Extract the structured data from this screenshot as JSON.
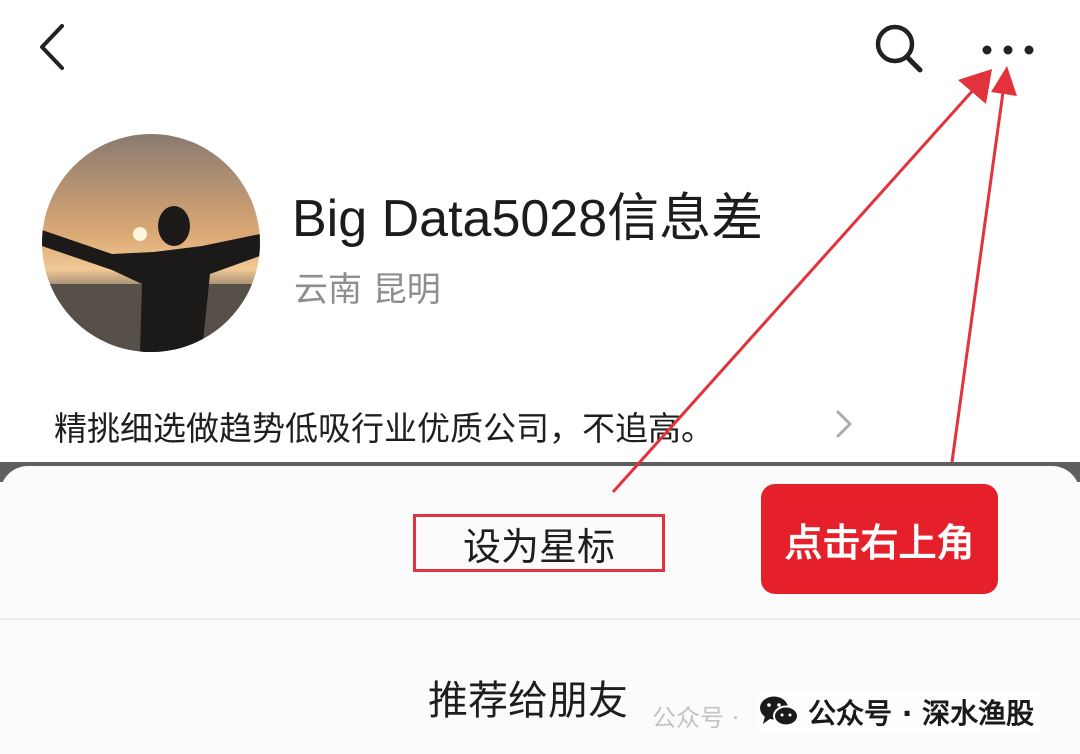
{
  "header": {
    "back_icon": "chevron-left-icon",
    "search_icon": "search-icon",
    "more_icon": "more-horizontal-icon"
  },
  "profile": {
    "name": "Big Data5028信息差",
    "location": "云南 昆明",
    "bio": "精挑细选做趋势低吸行业优质公司，不追高。",
    "bio_chevron_icon": "chevron-right-icon"
  },
  "sheet": {
    "star_option": "设为星标",
    "recommend_option": "推荐给朋友"
  },
  "annotation": {
    "hint_label": "点击右上角",
    "highlight_color": "#e5202a"
  },
  "watermark": {
    "faint_text": "公众号 ·",
    "icon": "wechat-icon",
    "text": "公众号 · 深水渔股"
  }
}
